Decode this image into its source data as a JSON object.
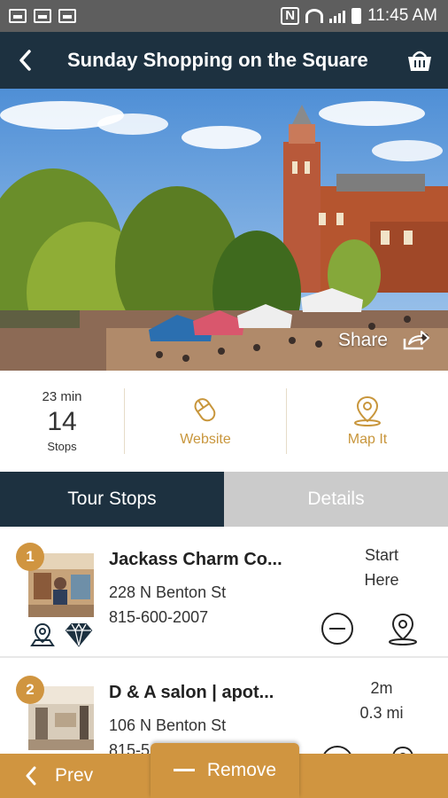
{
  "status_bar": {
    "time": "11:45 AM",
    "nfc": "N"
  },
  "header": {
    "title": "Sunday Shopping on the Square",
    "back_icon": "chevron-left-icon",
    "cart_icon": "basket-icon"
  },
  "hero": {
    "share_label": "Share"
  },
  "stats": {
    "duration": "23 min",
    "stops_count": "14",
    "stops_label": "Stops",
    "website_label": "Website",
    "map_label": "Map It"
  },
  "tabs": [
    {
      "label": "Tour Stops",
      "active": true
    },
    {
      "label": "Details",
      "active": false
    }
  ],
  "stops": [
    {
      "number": "1",
      "name": "Jackass Charm Co...",
      "address": "228 N Benton St",
      "phone": "815-600-2007",
      "meta_line1": "Start",
      "meta_line2": "Here"
    },
    {
      "number": "2",
      "name": "D & A salon | apot...",
      "address": "106 N Benton St",
      "phone": "815-5",
      "meta_line1": "2m",
      "meta_line2": "0.3 mi"
    }
  ],
  "bottom": {
    "prev_label": "Prev",
    "remove_label": "Remove"
  },
  "colors": {
    "navy": "#1d3140",
    "gold": "#d09540",
    "tab_inactive": "#cbcbcb"
  }
}
